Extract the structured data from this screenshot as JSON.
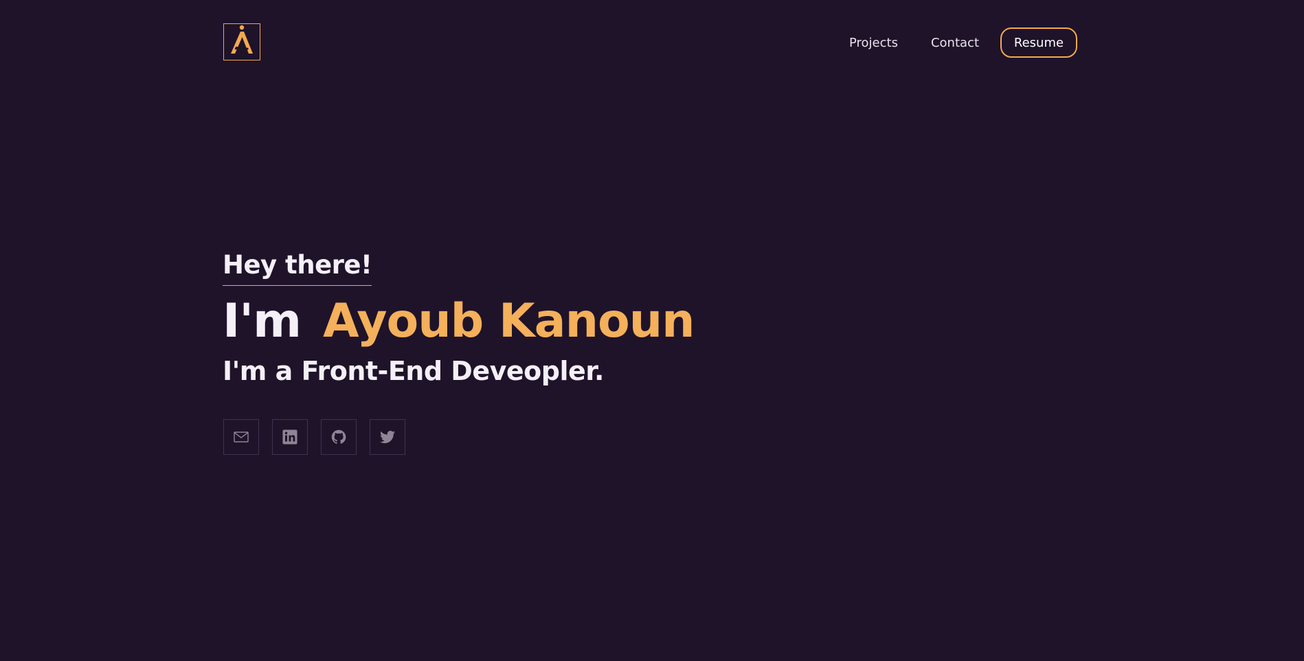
{
  "header": {
    "logo_letter": "A",
    "nav": {
      "projects_label": "Projects",
      "contact_label": "Contact",
      "resume_label": "Resume"
    }
  },
  "hero": {
    "greeting": "Hey there!",
    "im": "I'm",
    "name": "Ayoub Kanoun",
    "role_line": "I'm a Front-End Deveopler."
  },
  "socials": {
    "items": [
      {
        "icon": "mail-icon"
      },
      {
        "icon": "linkedin-icon"
      },
      {
        "icon": "github-icon"
      },
      {
        "icon": "twitter-icon"
      }
    ]
  },
  "colors": {
    "background": "#1f132a",
    "accent": "#f4a94e",
    "text": "#f5f0f8",
    "icon": "#8e8597"
  }
}
